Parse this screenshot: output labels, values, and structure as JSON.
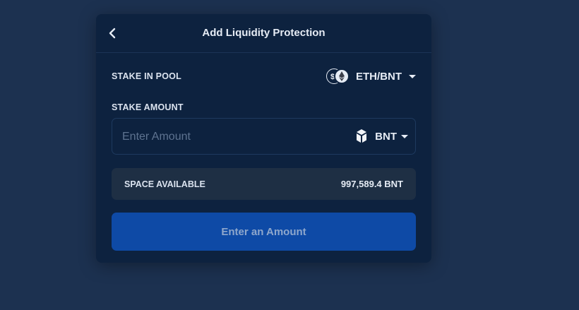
{
  "header": {
    "title": "Add Liquidity Protection",
    "back_icon": "chevron-left-icon"
  },
  "stake_pool": {
    "label": "STAKE IN POOL",
    "pool_name": "ETH/BNT"
  },
  "stake_amount": {
    "label": "STAKE AMOUNT",
    "placeholder": "Enter Amount",
    "value": "",
    "token": "BNT"
  },
  "space_available": {
    "label": "SPACE AVAILABLE",
    "value": "997,589.4 BNT"
  },
  "cta": {
    "label": "Enter an Amount"
  },
  "colors": {
    "page_bg": "#1c3150",
    "card_bg": "#0d223f",
    "button_bg": "#0e4aa6",
    "button_text": "#8ea7cc",
    "info_bg": "#1e2f44"
  }
}
